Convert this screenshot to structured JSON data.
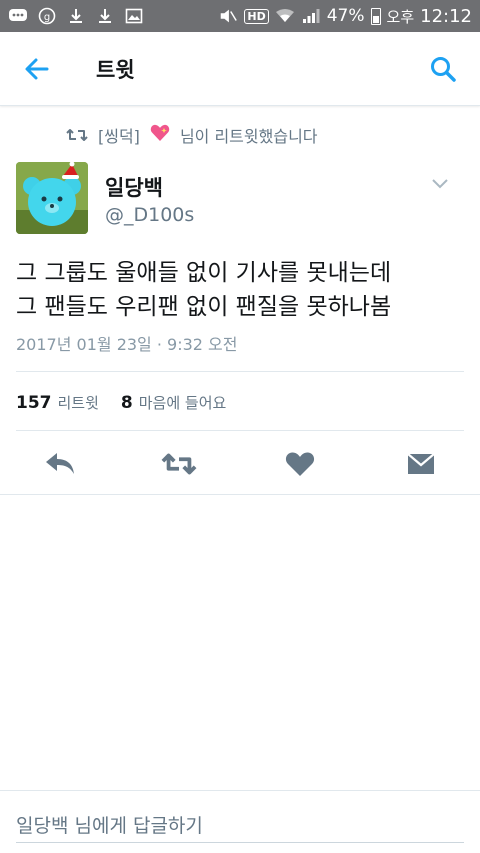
{
  "status_bar": {
    "battery": "47%",
    "ampm": "오후",
    "time": "12:12",
    "hd": "HD"
  },
  "header": {
    "title": "트윗"
  },
  "retweet_context": {
    "text": "[씽덕]",
    "suffix": "님이 리트윗했습니다"
  },
  "author": {
    "name": "일당백",
    "handle": "@_D100s"
  },
  "tweet": {
    "lines": [
      "그 그룹도 울애들 없이 기사를 못내는데",
      "그 팬들도 우리팬 없이 팬질을 못하나봄"
    ],
    "timestamp": "2017년 01월 23일 · 9:32 오전"
  },
  "stats": {
    "retweets_count": "157",
    "retweets_label": "리트윗",
    "likes_count": "8",
    "likes_label": "마음에 들어요"
  },
  "reply": {
    "placeholder": "일당백 님에게 답글하기"
  },
  "colors": {
    "accent": "#1da1f2",
    "icon_gray": "#657786",
    "statusbar": "#6e6f72"
  }
}
